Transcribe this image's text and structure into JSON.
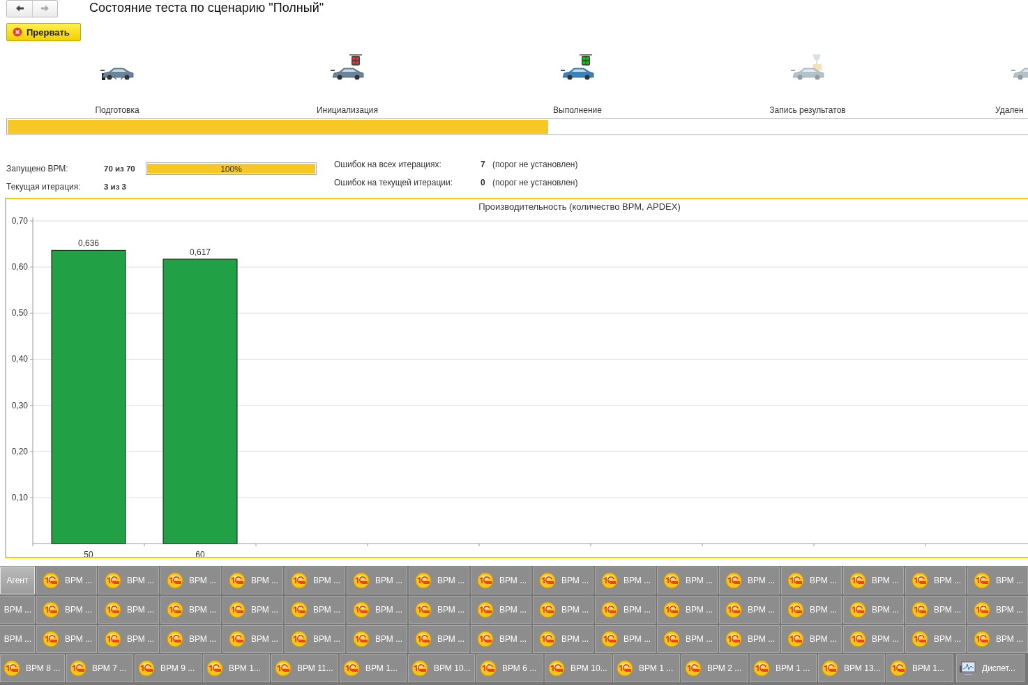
{
  "nav": [
    {
      "kind": "back",
      "disabled": false
    },
    {
      "kind": "forward",
      "disabled": true
    }
  ],
  "title": "Состояние теста по сценарию \"Полный\"",
  "stop_button": "Прервать",
  "stages": [
    {
      "kind": "jack",
      "label": "Подготовка",
      "selected": false,
      "disabled": false
    },
    {
      "kind": "light-red",
      "label": "Инициализация",
      "selected": false,
      "disabled": false
    },
    {
      "kind": "light-green",
      "label": "Выполнение",
      "selected": true,
      "disabled": false
    },
    {
      "kind": "trophy",
      "label": "Запись результатов",
      "selected": false,
      "disabled": true
    },
    {
      "kind": "car",
      "label": "Удален",
      "selected": false,
      "disabled": true
    }
  ],
  "overall_progress": {
    "level": 0.53
  },
  "stats_left": [
    {
      "label": "Запущено ВРМ:",
      "value": "70 из 70",
      "progress": {
        "level": 1.0,
        "text": "100%"
      }
    },
    {
      "label": "Текущая итерация:",
      "value": "3 из 3"
    }
  ],
  "stats_right": [
    {
      "label": "Ошибок на всех итерациях:",
      "value": "7",
      "note": "(порог не установлен)"
    },
    {
      "label": "Ошибок на текущей итерации:",
      "value": "0",
      "note": "(порог не установлен)"
    }
  ],
  "chart": {
    "chart_data": {
      "type": "bar",
      "title": "Производительность (количество ВРМ, APDEX)",
      "categories": [
        "50",
        "60"
      ],
      "series": [
        {
          "color": "#21a045",
          "values": [
            0.636,
            0.617
          ]
        }
      ],
      "grid": true,
      "ylim": [
        0,
        0.7
      ],
      "yticks": [
        {
          "value": 0.1,
          "label": "0,10"
        },
        {
          "value": 0.2,
          "label": "0,20"
        },
        {
          "value": 0.3,
          "label": "0,30"
        },
        {
          "value": 0.4,
          "label": "0,40"
        },
        {
          "value": 0.5,
          "label": "0,50"
        },
        {
          "value": 0.6,
          "label": "0,60"
        },
        {
          "value": 0.7,
          "label": "0,70"
        }
      ],
      "value_labels": [
        "0,636",
        "0,617"
      ]
    }
  },
  "taskbar": {
    "rows": [
      {
        "items": [
          {
            "kind": "agent",
            "label": "Агент",
            "selected": true
          },
          {
            "kind": "app",
            "label": "ВРМ ...",
            "selected": false
          },
          {
            "kind": "app",
            "label": "ВРМ ...",
            "selected": false
          },
          {
            "kind": "app",
            "label": "ВРМ ...",
            "selected": false
          },
          {
            "kind": "app",
            "label": "ВРМ ...",
            "selected": false
          },
          {
            "kind": "app",
            "label": "ВРМ ...",
            "selected": false
          },
          {
            "kind": "app",
            "label": "ВРМ ...",
            "selected": false
          },
          {
            "kind": "app",
            "label": "ВРМ ...",
            "selected": false
          },
          {
            "kind": "app",
            "label": "ВРМ ...",
            "selected": false
          },
          {
            "kind": "app",
            "label": "ВРМ ...",
            "selected": false
          },
          {
            "kind": "app",
            "label": "ВРМ ...",
            "selected": false
          },
          {
            "kind": "app",
            "label": "ВРМ ...",
            "selected": false
          },
          {
            "kind": "app",
            "label": "ВРМ ...",
            "selected": false
          },
          {
            "kind": "app",
            "label": "ВРМ ...",
            "selected": false
          },
          {
            "kind": "app",
            "label": "ВРМ ...",
            "selected": false
          },
          {
            "kind": "app",
            "label": "ВРМ ...",
            "selected": false
          },
          {
            "kind": "app",
            "label": "ВРМ ...",
            "selected": false
          }
        ]
      },
      {
        "items": [
          {
            "kind": "app",
            "label": "ВРМ ...",
            "selected": false
          },
          {
            "kind": "app",
            "label": "ВРМ ...",
            "selected": false
          },
          {
            "kind": "app",
            "label": "ВРМ ...",
            "selected": false
          },
          {
            "kind": "app",
            "label": "ВРМ ...",
            "selected": false
          },
          {
            "kind": "app",
            "label": "ВРМ ...",
            "selected": false
          },
          {
            "kind": "app",
            "label": "ВРМ ...",
            "selected": false
          },
          {
            "kind": "app",
            "label": "ВРМ ...",
            "selected": false
          },
          {
            "kind": "app",
            "label": "ВРМ ...",
            "selected": false
          },
          {
            "kind": "app",
            "label": "ВРМ ...",
            "selected": false
          },
          {
            "kind": "app",
            "label": "ВРМ ...",
            "selected": false
          },
          {
            "kind": "app",
            "label": "ВРМ ...",
            "selected": false
          },
          {
            "kind": "app",
            "label": "ВРМ ...",
            "selected": false
          },
          {
            "kind": "app",
            "label": "ВРМ ...",
            "selected": false
          },
          {
            "kind": "app",
            "label": "ВРМ ...",
            "selected": false
          },
          {
            "kind": "app",
            "label": "ВРМ ...",
            "selected": false
          },
          {
            "kind": "app",
            "label": "ВРМ ...",
            "selected": false
          },
          {
            "kind": "app",
            "label": "ВРМ ...",
            "selected": false
          }
        ]
      },
      {
        "items": [
          {
            "kind": "app",
            "label": "ВРМ ...",
            "selected": false
          },
          {
            "kind": "app",
            "label": "ВРМ ...",
            "selected": false
          },
          {
            "kind": "app",
            "label": "ВРМ ...",
            "selected": false
          },
          {
            "kind": "app",
            "label": "ВРМ ...",
            "selected": false
          },
          {
            "kind": "app",
            "label": "ВРМ ...",
            "selected": false
          },
          {
            "kind": "app",
            "label": "ВРМ ...",
            "selected": false
          },
          {
            "kind": "app",
            "label": "ВРМ ...",
            "selected": false
          },
          {
            "kind": "app",
            "label": "ВРМ ...",
            "selected": false
          },
          {
            "kind": "app",
            "label": "ВРМ ...",
            "selected": false
          },
          {
            "kind": "app",
            "label": "ВРМ ...",
            "selected": false
          },
          {
            "kind": "app",
            "label": "ВРМ ...",
            "selected": false
          },
          {
            "kind": "app",
            "label": "ВРМ ...",
            "selected": false
          },
          {
            "kind": "app",
            "label": "ВРМ ...",
            "selected": false
          },
          {
            "kind": "app",
            "label": "ВРМ ...",
            "selected": false
          },
          {
            "kind": "app",
            "label": "ВРМ ...",
            "selected": false
          },
          {
            "kind": "app",
            "label": "ВРМ ...",
            "selected": false
          },
          {
            "kind": "app",
            "label": "ВРМ ...",
            "selected": false
          }
        ]
      },
      {
        "items": [
          {
            "kind": "app",
            "label": "ВРМ 8 ...",
            "selected": false
          },
          {
            "kind": "app",
            "label": "ВРМ 7 ...",
            "selected": false
          },
          {
            "kind": "app",
            "label": "ВРМ 9 ...",
            "selected": false
          },
          {
            "kind": "app",
            "label": "ВРМ 1...",
            "selected": false
          },
          {
            "kind": "app",
            "label": "ВРМ 11...",
            "selected": false
          },
          {
            "kind": "app",
            "label": "ВРМ 1...",
            "selected": false
          },
          {
            "kind": "app",
            "label": "ВРМ 10...",
            "selected": false
          },
          {
            "kind": "app",
            "label": "ВРМ 6 ...",
            "selected": false
          },
          {
            "kind": "app",
            "label": "ВРМ 10...",
            "selected": false
          },
          {
            "kind": "app",
            "label": "ВРМ 1 ...",
            "selected": false
          },
          {
            "kind": "app",
            "label": "ВРМ 2 ...",
            "selected": false
          },
          {
            "kind": "app",
            "label": "ВРМ 1 ...",
            "selected": false
          },
          {
            "kind": "app",
            "label": "ВРМ 13...",
            "selected": false
          },
          {
            "kind": "app",
            "label": "ВРМ 1...",
            "selected": false
          },
          {
            "kind": "monitor",
            "label": "Диспет...",
            "selected": false
          }
        ]
      }
    ]
  }
}
